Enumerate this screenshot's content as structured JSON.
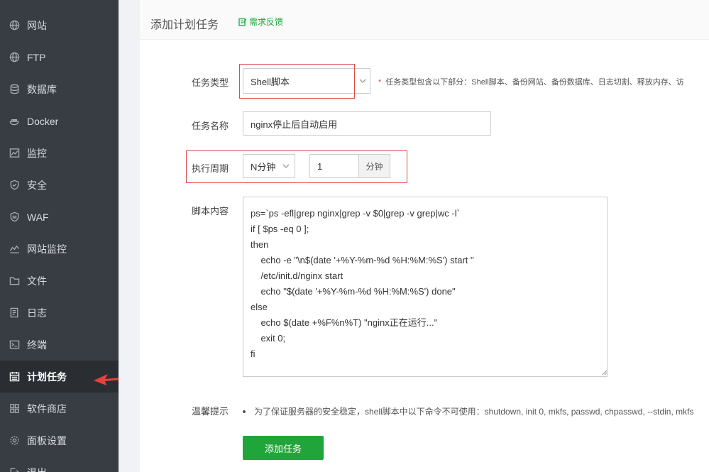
{
  "sidebar": {
    "items": [
      {
        "label": "网站",
        "icon": "globe-icon"
      },
      {
        "label": "FTP",
        "icon": "globe-icon"
      },
      {
        "label": "数据库",
        "icon": "database-icon"
      },
      {
        "label": "Docker",
        "icon": "docker-icon"
      },
      {
        "label": "监控",
        "icon": "monitor-chart-icon"
      },
      {
        "label": "安全",
        "icon": "shield-icon"
      },
      {
        "label": "WAF",
        "icon": "waf-shield-icon"
      },
      {
        "label": "网站监控",
        "icon": "line-chart-icon"
      },
      {
        "label": "文件",
        "icon": "folder-icon"
      },
      {
        "label": "日志",
        "icon": "log-icon"
      },
      {
        "label": "终端",
        "icon": "terminal-icon"
      },
      {
        "label": "计划任务",
        "icon": "calendar-icon",
        "active": true
      },
      {
        "label": "软件商店",
        "icon": "apps-grid-icon"
      },
      {
        "label": "面板设置",
        "icon": "gear-icon"
      },
      {
        "label": "退出",
        "icon": "logout-icon"
      }
    ]
  },
  "header": {
    "title": "添加计划任务",
    "feedback_label": "需求反馈"
  },
  "form": {
    "task_type": {
      "label": "任务类型",
      "value": "Shell脚本",
      "hint": "任务类型包含以下部分：Shell脚本、备份网站、备份数据库、日志切割、释放内存、访"
    },
    "task_name": {
      "label": "任务名称",
      "value": "nginx停止后自动启用"
    },
    "schedule": {
      "label": "执行周期",
      "period_value": "N分钟",
      "interval_value": "1",
      "interval_unit": "分钟"
    },
    "script": {
      "label": "脚本内容",
      "content": "ps=`ps -efl|grep nginx|grep -v $0|grep -v grep|wc -l`\nif [ $ps -eq 0 ];\nthen\n    echo -e \"\\n$(date '+%Y-%m-%d %H:%M:%S') start \"\n    /etc/init.d/nginx start\n    echo \"$(date '+%Y-%m-%d %H:%M:%S') done\"\nelse\n    echo $(date +%F%n%T) \"nginx正在运行...\"\n    exit 0;\nfi"
    },
    "tips": {
      "label": "温馨提示",
      "text": "为了保证服务器的安全稳定，shell脚本中以下命令不可使用：shutdown, init 0, mkfs, passwd, chpasswd, --stdin, mkfs"
    },
    "submit_label": "添加任务"
  },
  "colors": {
    "sidebar_bg": "#383d44",
    "sidebar_active_bg": "#2a2e33",
    "accent_green": "#20a53a",
    "highlight_red": "#e04a4a",
    "arrow_red": "#e8413c"
  }
}
